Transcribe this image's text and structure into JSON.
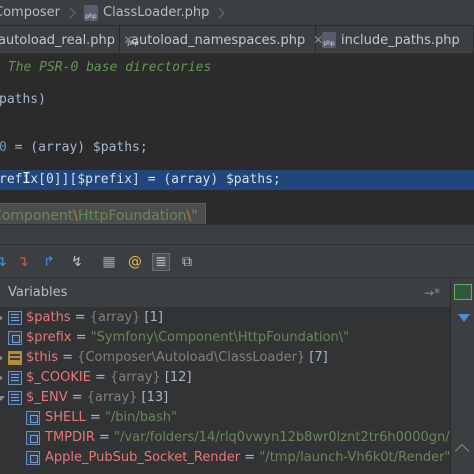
{
  "breadcrumb": {
    "items": [
      "Composer",
      "ClassLoader.php"
    ]
  },
  "tabs": [
    {
      "label": "autoload_real.php"
    },
    {
      "label": "autoload_namespaces.php"
    },
    {
      "label": "include_paths.php"
    }
  ],
  "editor": {
    "line_doc": " The PSR-0 base directories",
    "line_paths": "paths)",
    "line_assign_num": "0",
    "line_assign_rest": " = (array) $paths;",
    "line_highlight": "refix[0]][$prefix] = (array) $paths;",
    "tooltip_str1": "Component",
    "tooltip_sep1": "\\",
    "tooltip_str2": "HttpFoundation",
    "tooltip_sep2": "\\",
    "tooltip_end": "\""
  },
  "debugger": {
    "panel_title": "Variables",
    "pin_label": "→*"
  },
  "variables": [
    {
      "name": "$paths",
      "eq": " = ",
      "type": "{array}",
      "count": " [1]",
      "icon": "array-icon",
      "expand": "collapsed"
    },
    {
      "name": "$prefix",
      "eq": " = ",
      "str": "\"Symfony\\Component\\HttpFoundation\\\"",
      "icon": "string-icon",
      "expand": "none"
    },
    {
      "name": "$this",
      "eq": " = ",
      "type": "{Composer\\Autoload\\ClassLoader}",
      "count": " [7]",
      "icon": "object-icon",
      "expand": "collapsed"
    },
    {
      "name": "$_COOKIE",
      "eq": " = ",
      "type": "{array}",
      "count": " [12]",
      "icon": "array-icon",
      "expand": "collapsed"
    },
    {
      "name": "$_ENV",
      "eq": " = ",
      "type": "{array}",
      "count": " [13]",
      "icon": "array-icon",
      "expand": "expanded"
    },
    {
      "name": "SHELL",
      "eq": " = ",
      "str": "\"/bin/bash\"",
      "icon": "string-icon",
      "expand": "none"
    },
    {
      "name": "TMPDIR",
      "eq": " = ",
      "str": "\"/var/folders/14/rlq0vwyn12b8wr0lznt2tr6h0000gn/\"",
      "icon": "string-icon",
      "expand": "none"
    },
    {
      "name": "Apple_PubSub_Socket_Render",
      "eq": " = ",
      "str": "\"/tmp/launch-Vh6k0t/Render\"",
      "icon": "string-icon",
      "expand": "none"
    }
  ]
}
